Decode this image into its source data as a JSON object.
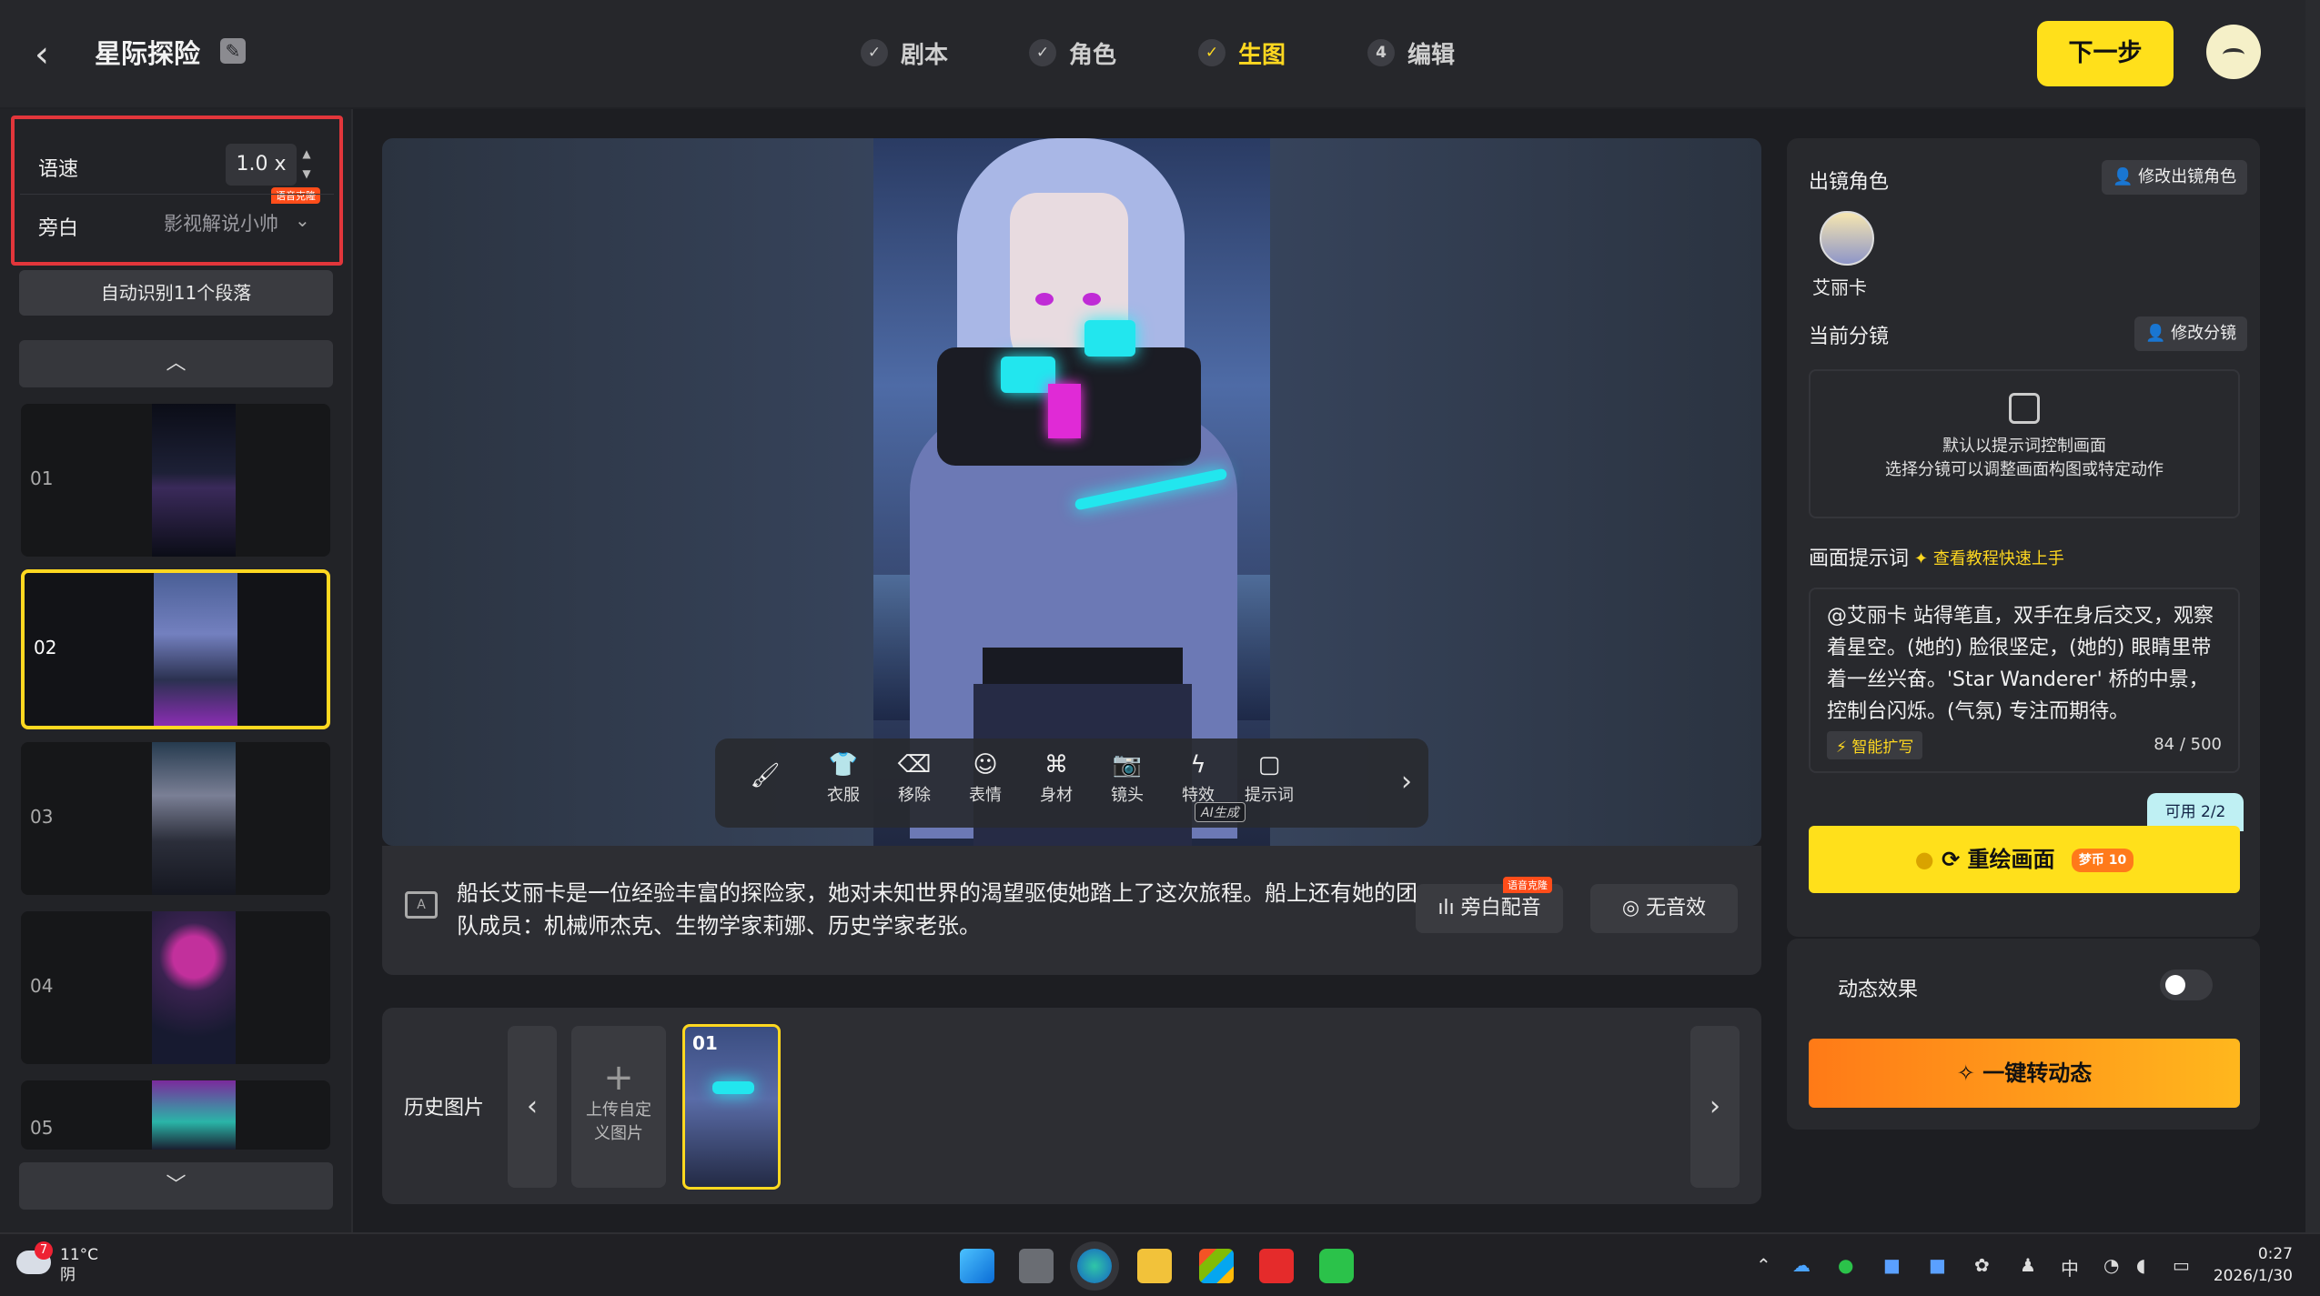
{
  "header": {
    "title": "星际探险",
    "steps": [
      {
        "label": "剧本",
        "marker": "✓"
      },
      {
        "label": "角色",
        "marker": "✓"
      },
      {
        "label": "生图",
        "marker": "✓"
      },
      {
        "label": "编辑",
        "marker": "4"
      }
    ],
    "next_label": "下一步",
    "accent": "#ffd820"
  },
  "left": {
    "speed_label": "语速",
    "speed_value": "1.0 x",
    "clone_badge": "语音克隆",
    "narrator_label": "旁白",
    "narrator_value": "影视解说小帅",
    "auto_detect": "自动识别11个段落",
    "thumbs": [
      {
        "num": "01"
      },
      {
        "num": "02"
      },
      {
        "num": "03"
      },
      {
        "num": "04"
      },
      {
        "num": "05"
      }
    ]
  },
  "canvas": {
    "tools": [
      "衣服",
      "移除",
      "表情",
      "身材",
      "镜头",
      "特效",
      "提示词"
    ],
    "ai_tag": "AI生成"
  },
  "narration": {
    "text": "船长艾丽卡是一位经验丰富的探险家，她对未知世界的渴望驱使她踏上了这次旅程。船上还有她的团队成员：机械师杰克、生物学家莉娜、历史学家老张。",
    "voice_btn": "旁白配音",
    "clone_badge": "语音克隆",
    "sfx_btn": "无音效"
  },
  "history": {
    "label": "历史图片",
    "upload": "上传自定义图片",
    "thumb_num": "01"
  },
  "right": {
    "role_title": "出镜角色",
    "edit_role": "修改出镜角色",
    "role_name": "艾丽卡",
    "shot_title": "当前分镜",
    "edit_shot": "修改分镜",
    "hint1": "默认以提示词控制画面",
    "hint2": "选择分镜可以调整画面构图或特定动作",
    "prompt_title": "画面提示词",
    "tutorial": "查看教程快速上手",
    "prompt": "@艾丽卡 站得笔直，双手在身后交叉，观察着星空。(她的) 脸很坚定，(她的) 眼睛里带着一丝兴奋。'Star Wanderer' 桥的中景，控制台闪烁。(气氛) 专注而期待。",
    "expand": "智能扩写",
    "count": "84 / 500",
    "available": "可用",
    "available_count": "2/2",
    "redraw": "重绘画面",
    "coin_label": "梦币",
    "coin": "10",
    "dynamic_title": "动态效果",
    "dynamic_btn": "一键转动态"
  },
  "taskbar": {
    "temp": "11°C",
    "weather": "阴",
    "weather_badge": "7",
    "ime": "中",
    "time": "0:27",
    "date": "2026/1/30"
  }
}
